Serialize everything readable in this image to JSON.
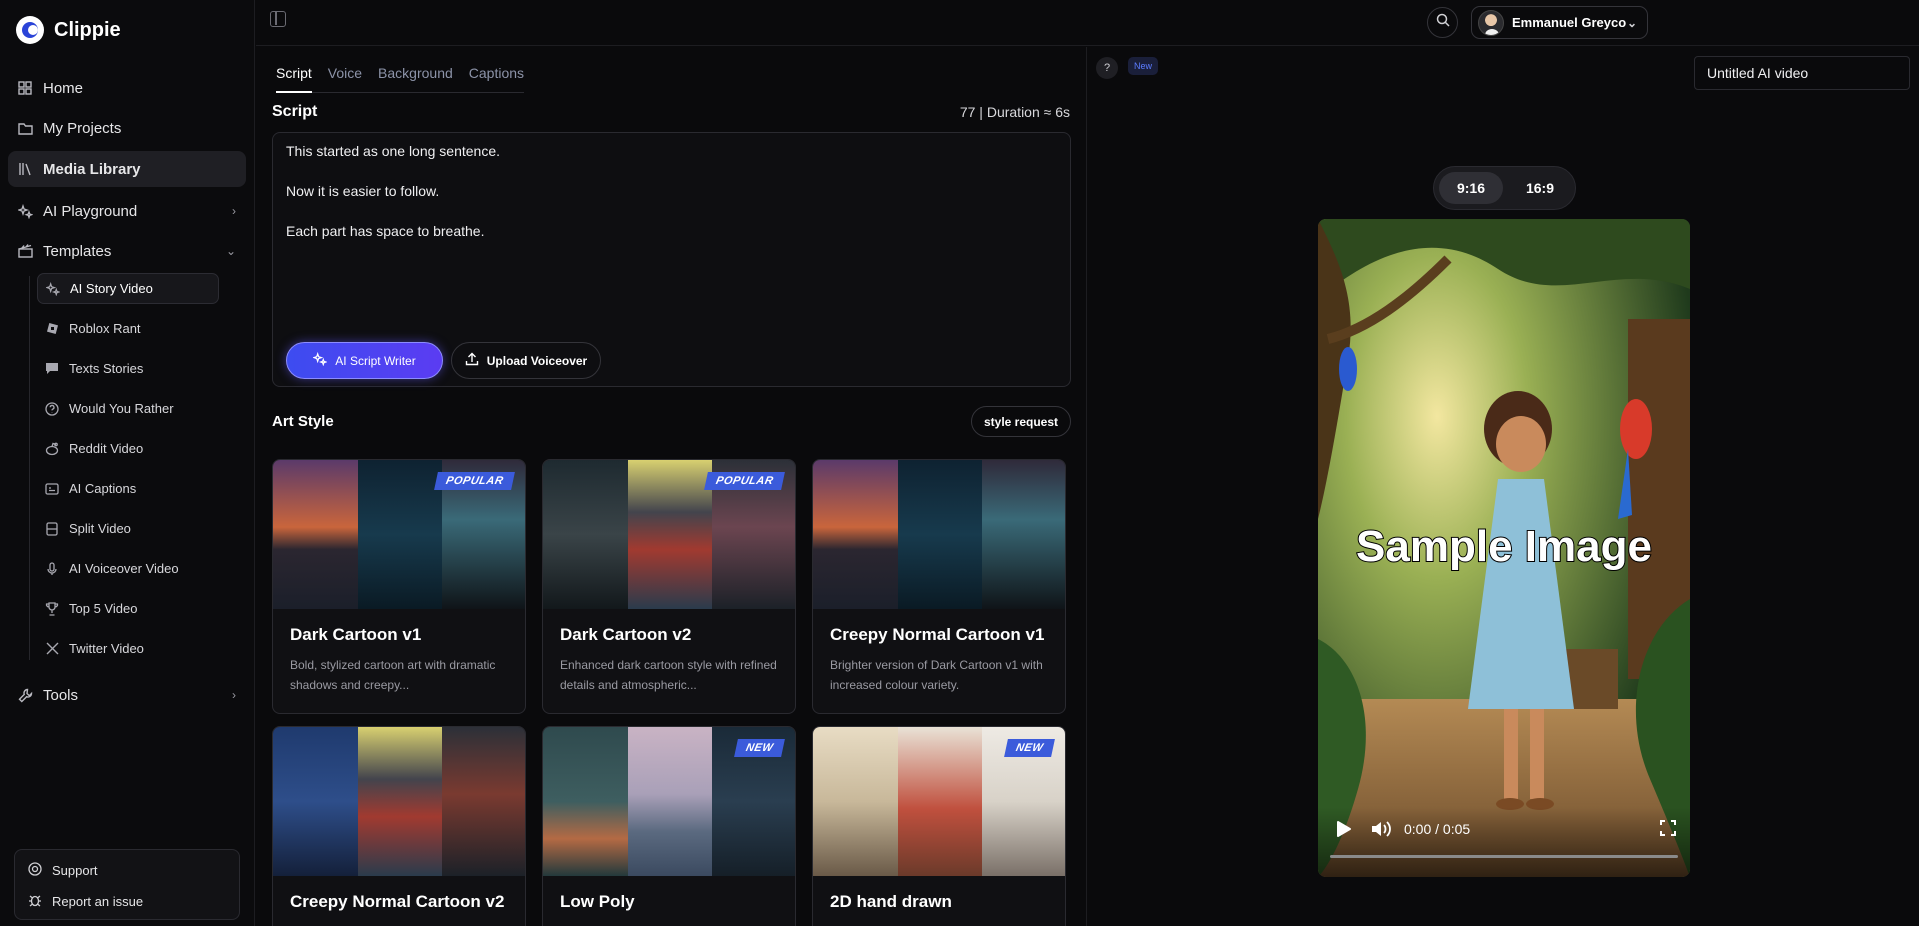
{
  "app": {
    "name": "Clippie"
  },
  "sidebar": {
    "items": [
      {
        "label": "Home",
        "icon": "grid-icon"
      },
      {
        "label": "My Projects",
        "icon": "folder-icon"
      },
      {
        "label": "Media Library",
        "icon": "library-icon",
        "active": true
      },
      {
        "label": "AI Playground",
        "icon": "sparkle-icon"
      },
      {
        "label": "Templates",
        "icon": "clapper-icon",
        "expanded": true
      },
      {
        "label": "Tools",
        "icon": "wrench-icon"
      }
    ],
    "templates": [
      {
        "label": "AI Story Video",
        "icon": "sparkle-icon",
        "active": true
      },
      {
        "label": "Roblox Rant",
        "icon": "roblox-icon"
      },
      {
        "label": "Texts Stories",
        "icon": "message-icon"
      },
      {
        "label": "Would You Rather",
        "icon": "question-icon"
      },
      {
        "label": "Reddit Video",
        "icon": "reddit-icon"
      },
      {
        "label": "AI Captions",
        "icon": "captions-icon"
      },
      {
        "label": "Split Video",
        "icon": "split-icon"
      },
      {
        "label": "AI Voiceover Video",
        "icon": "mic-icon"
      },
      {
        "label": "Top 5 Video",
        "icon": "trophy-icon"
      },
      {
        "label": "Twitter Video",
        "icon": "x-icon"
      }
    ],
    "support": {
      "support_label": "Support",
      "report_label": "Report an issue"
    }
  },
  "header": {
    "user_name": "Emmanuel Greyco"
  },
  "editor": {
    "tabs": [
      "Script",
      "Voice",
      "Background",
      "Captions"
    ],
    "active_tab": "Script",
    "script_heading": "Script",
    "duration": "77 | Duration ≈ 6s",
    "script_lines": [
      "This started as one long sentence.",
      "Now it is easier to follow.",
      "Each part has space to breathe."
    ],
    "ai_writer_label": "AI Script Writer",
    "upload_label": "Upload Voiceover",
    "art_style_heading": "Art Style",
    "style_request_label": "style request",
    "cards": [
      {
        "title": "Dark Cartoon v1",
        "desc": "Bold, stylized cartoon art with dramatic shadows and creepy...",
        "badge": "POPULAR"
      },
      {
        "title": "Dark Cartoon v2",
        "desc": "Enhanced dark cartoon style with refined details and atmospheric...",
        "badge": "POPULAR"
      },
      {
        "title": "Creepy Normal Cartoon v1",
        "desc": "Brighter version of Dark Cartoon v1 with increased colour variety.",
        "badge": ""
      },
      {
        "title": "Creepy Normal Cartoon v2",
        "desc": "",
        "badge": ""
      },
      {
        "title": "Low Poly",
        "desc": "",
        "badge": "NEW"
      },
      {
        "title": "2D hand drawn",
        "desc": "",
        "badge": "NEW"
      }
    ]
  },
  "preview": {
    "help_label": "?",
    "new_label": "New",
    "project_title": "Untitled AI video",
    "ratios": [
      "9:16",
      "16:9"
    ],
    "active_ratio": "9:16",
    "overlay_text": "Sample Image",
    "time": "0:00 / 0:05",
    "progress": 0
  }
}
